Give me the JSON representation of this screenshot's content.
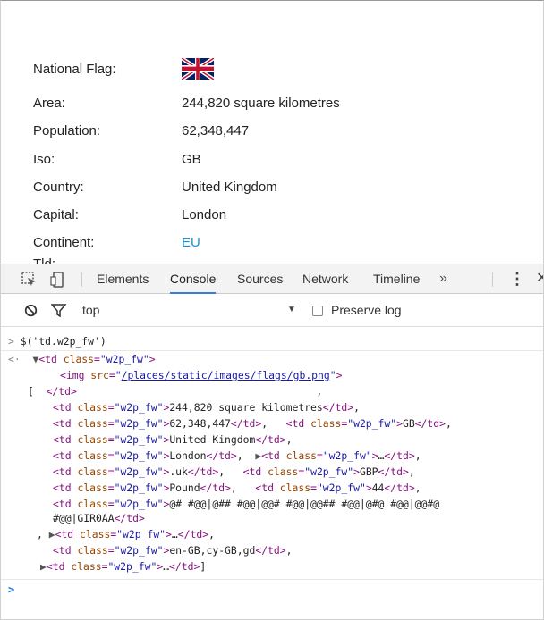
{
  "page": {
    "rows": [
      {
        "label": "National Flag:",
        "value": ""
      },
      {
        "label": "Area:",
        "value": "244,820 square kilometres"
      },
      {
        "label": "Population:",
        "value": "62,348,447"
      },
      {
        "label": "Iso:",
        "value": "GB"
      },
      {
        "label": "Country:",
        "value": "United Kingdom"
      },
      {
        "label": "Capital:",
        "value": "London"
      },
      {
        "label": "Continent:",
        "value": "EU"
      }
    ],
    "clipped_label": "Tld:"
  },
  "devtools": {
    "tabs": [
      "Elements",
      "Console",
      "Sources",
      "Network",
      "Timeline"
    ],
    "active_tab": "Console",
    "more": "»",
    "kebab": "⋮",
    "close": "✕"
  },
  "console_bar": {
    "context": "top",
    "preserve_log": "Preserve log"
  },
  "console": {
    "command": "$('td.w2p_fw')",
    "img_src": "/places/static/images/flags/gb.png",
    "bottom_prompt": ">"
  },
  "colors": {
    "tag": "#881280",
    "attr": "#994500",
    "value": "#1a1aa6",
    "active_tab": "#3879d9",
    "link": "#1a8fd6"
  }
}
